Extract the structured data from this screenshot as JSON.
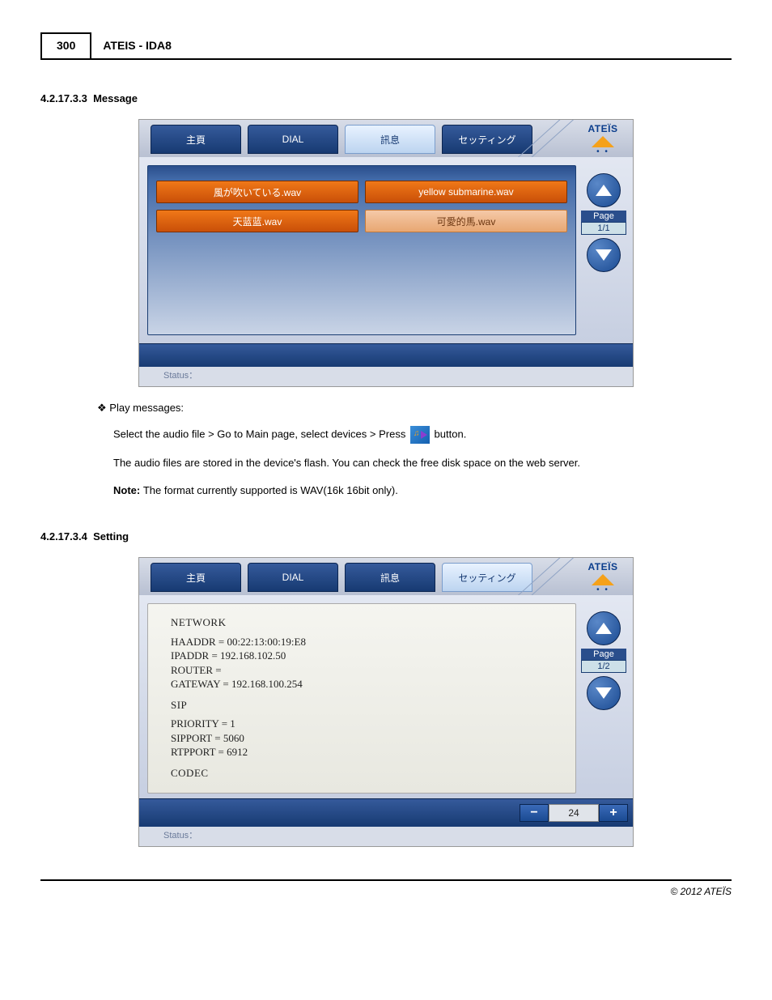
{
  "header": {
    "page_number": "300",
    "title": "ATEIS - IDA8"
  },
  "section1": {
    "number": "4.2.17.3.3",
    "title": "Message"
  },
  "screenshot1": {
    "tabs": [
      "主頁",
      "DIAL",
      "訊息",
      "セッティング"
    ],
    "active_tab_index": 2,
    "logo": "ATEÏS",
    "files": [
      "風が吹いている.wav",
      "yellow submarine.wav",
      "天蓝蓝.wav",
      "可愛的馬.wav"
    ],
    "light_index": 3,
    "page_label": "Page",
    "page_count": "1/1",
    "status_label": "Status："
  },
  "text1": {
    "bullet": "Play messages:",
    "line1a": "Select the audio file > Go to Main page, select devices > Press ",
    "line1b": " button.",
    "line2": "The audio files are stored in the device's flash. You can check the free disk space on the web server.",
    "line3_label": "Note: ",
    "line3": "The format currently supported is WAV(16k 16bit only)."
  },
  "section2": {
    "number": "4.2.17.3.4",
    "title": "Setting"
  },
  "screenshot2": {
    "tabs": [
      "主頁",
      "DIAL",
      "訊息",
      "セッティング"
    ],
    "active_tab_index": 3,
    "logo": "ATEÏS",
    "network_heading": "NETWORK",
    "network_lines": [
      "HAADDR = 00:22:13:00:19:E8",
      "IPADDR = 192.168.102.50",
      "ROUTER =",
      "GATEWAY = 192.168.100.254"
    ],
    "sip_heading": "SIP",
    "sip_lines": [
      "PRIORITY = 1",
      "SIPPORT = 5060",
      "RTPPORT = 6912"
    ],
    "codec_heading": "CODEC",
    "page_label": "Page",
    "page_count": "1/2",
    "spinner_value": "24",
    "status_label": "Status："
  },
  "footer": "© 2012 ATEÏS"
}
